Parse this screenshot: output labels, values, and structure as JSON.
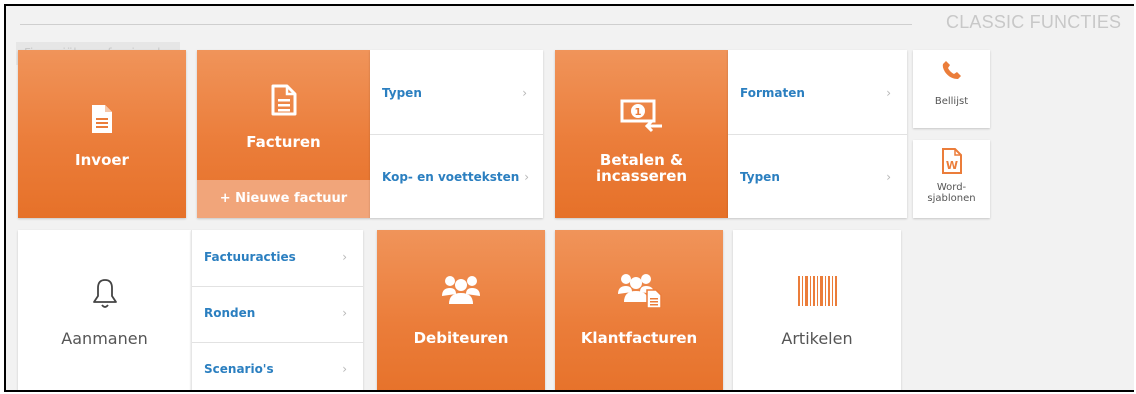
{
  "header": {
    "section_title": "CLASSIC FUNCTIES",
    "ghost_label": "Financiële professionals"
  },
  "tiles": {
    "invoer": {
      "label": "Invoer",
      "icon": "document-icon"
    },
    "facturen": {
      "label": "Facturen",
      "icon": "invoice-icon",
      "new_button": "+ Nieuwe factuur",
      "menu": [
        {
          "label": "Typen",
          "chevron": "›"
        },
        {
          "label": "Kop- en voetteksten",
          "chevron": "›"
        }
      ]
    },
    "betalen": {
      "label_line1": "Betalen &",
      "label_line2": "incasseren",
      "icon": "payment-icon",
      "menu": [
        {
          "label": "Formaten",
          "chevron": "›"
        },
        {
          "label": "Typen",
          "chevron": "›"
        }
      ]
    },
    "aanmanen": {
      "label": "Aanmanen",
      "icon": "bell-icon",
      "menu": [
        {
          "label": "Factuuracties",
          "chevron": "›"
        },
        {
          "label": "Ronden",
          "chevron": "›"
        },
        {
          "label": "Scenario's",
          "chevron": "›"
        }
      ]
    },
    "debiteuren": {
      "label": "Debiteuren",
      "icon": "users-icon"
    },
    "klantfacturen": {
      "label": "Klantfacturen",
      "icon": "users-document-icon"
    },
    "artikelen": {
      "label": "Artikelen",
      "icon": "barcode-icon"
    }
  },
  "classic": {
    "bellijst": {
      "label": "Bellijst",
      "icon": "phone-icon"
    },
    "word": {
      "label_line1": "Word-",
      "label_line2": "sjablonen",
      "icon": "word-document-icon"
    }
  },
  "colors": {
    "orange": "#eb7d3a",
    "orange_light": "#f1a57a",
    "link_blue": "#2b7fc0"
  }
}
